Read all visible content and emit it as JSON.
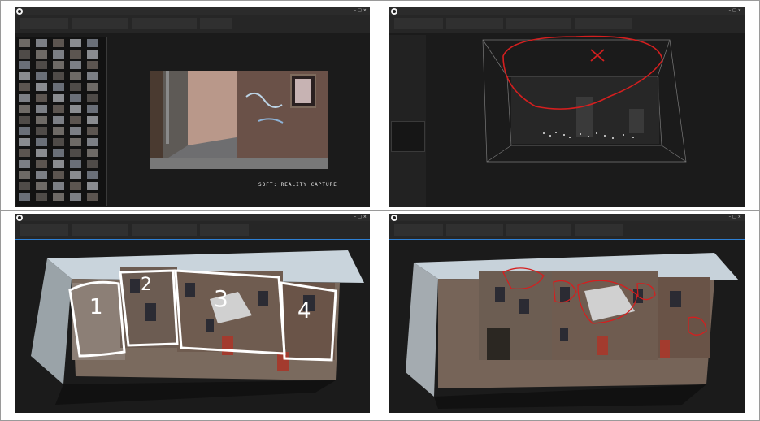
{
  "panels": [
    {
      "id": "top-left",
      "annotation": "SOFT: REALITY CAPTURE"
    },
    {
      "id": "top-right"
    },
    {
      "id": "bottom-left",
      "region_numbers": [
        "1",
        "2",
        "3",
        "4"
      ]
    },
    {
      "id": "bottom-right"
    }
  ],
  "app": {
    "accent_color": "#2d7fd3",
    "background_color": "#1d1d1d",
    "annotation_color_red": "#d41f1f",
    "annotation_color_white": "#ffffff"
  },
  "icons": {
    "app_logo": "capture-logo-icon",
    "window_controls": "window-controls-icon"
  }
}
